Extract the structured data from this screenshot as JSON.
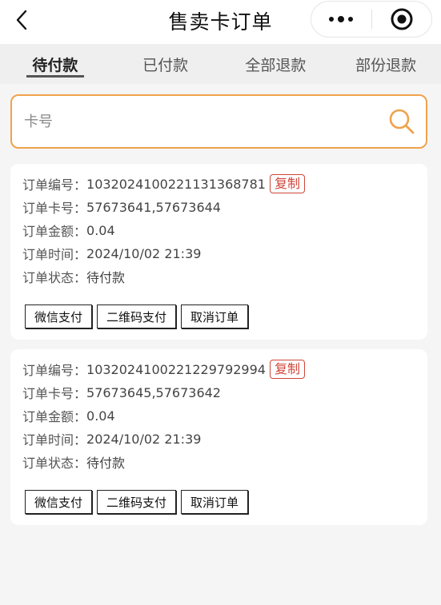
{
  "header": {
    "title": "售卖卡订单",
    "back_icon": "chevron-left-icon",
    "more_icon": "more-dots-icon",
    "close_icon": "target-circle-icon"
  },
  "tabs": [
    {
      "label": "待付款",
      "active": true
    },
    {
      "label": "已付款",
      "active": false
    },
    {
      "label": "全部退款",
      "active": false
    },
    {
      "label": "部份退款",
      "active": false
    }
  ],
  "search": {
    "placeholder": "卡号",
    "value": "",
    "accent_color": "#f0a24c"
  },
  "orders": [
    {
      "number_label": "订单编号：",
      "number": "1032024100221131368781",
      "copy_label": "复制",
      "cards_label": "订单卡号：",
      "cards": "57673641,57673644",
      "amount_label": "订单金额：",
      "amount": "0.04",
      "time_label": "订单时间：",
      "time": "2024/10/02 21:39",
      "status_label": "订单状态：",
      "status": "待付款",
      "actions": [
        "微信支付",
        "二维码支付",
        "取消订单"
      ]
    },
    {
      "number_label": "订单编号：",
      "number": "1032024100221229792994",
      "copy_label": "复制",
      "cards_label": "订单卡号：",
      "cards": "57673645,57673642",
      "amount_label": "订单金额：",
      "amount": "0.04",
      "time_label": "订单时间：",
      "time": "2024/10/02 21:39",
      "status_label": "订单状态：",
      "status": "待付款",
      "actions": [
        "微信支付",
        "二维码支付",
        "取消订单"
      ]
    }
  ],
  "colors": {
    "copy_red": "#d0453a",
    "page_bg": "#f5f5f5"
  }
}
